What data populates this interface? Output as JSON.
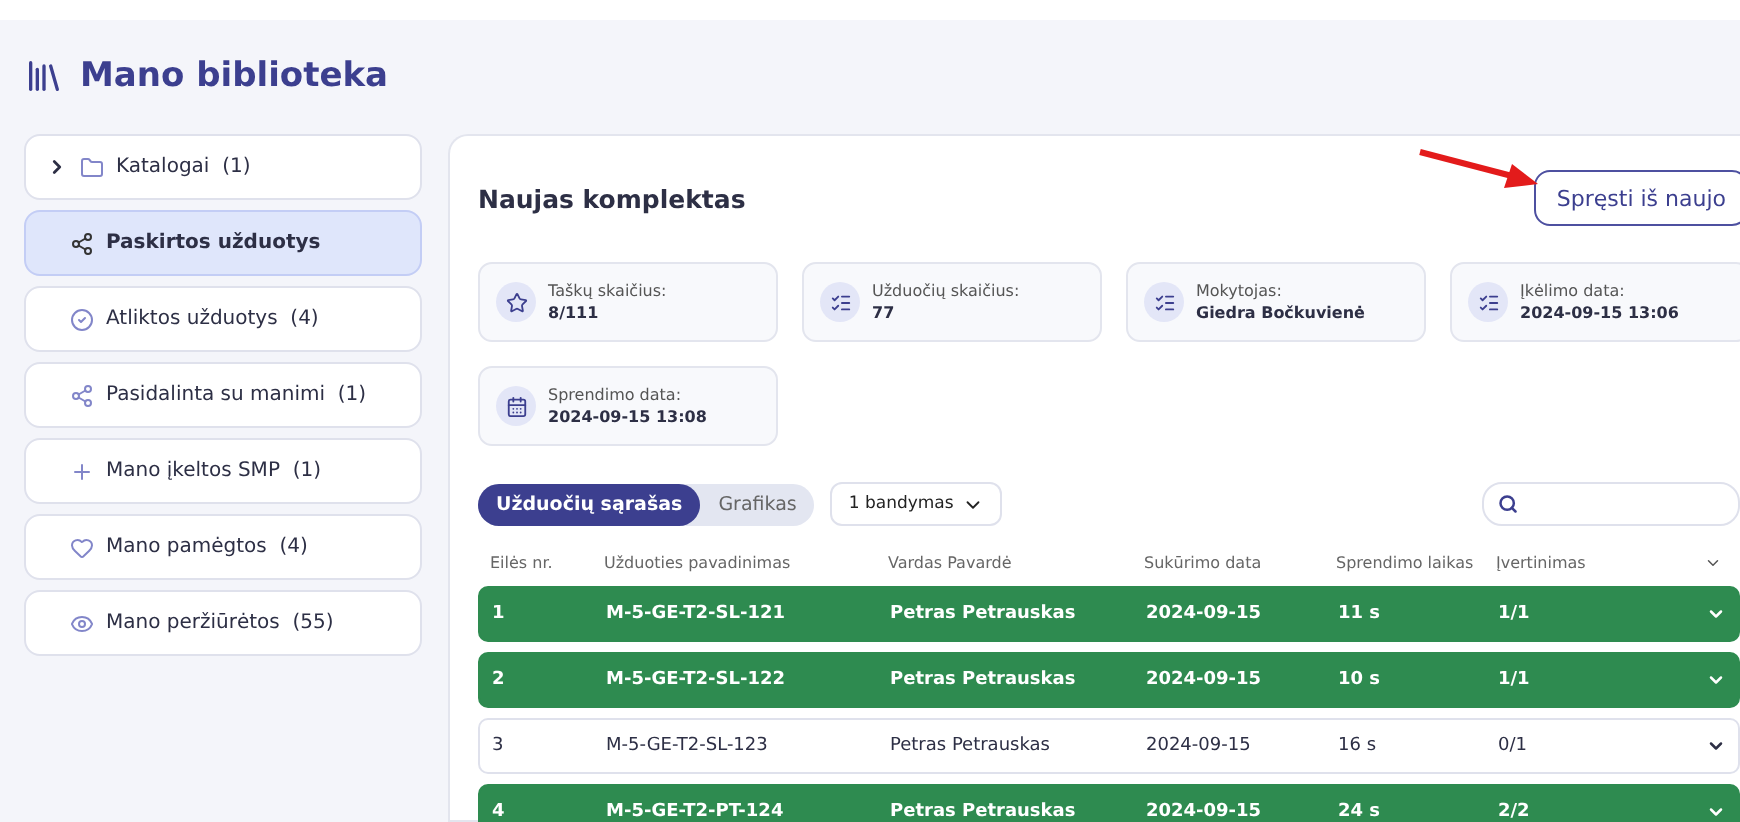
{
  "header": {
    "title": "Mano biblioteka"
  },
  "sidebar": {
    "items": [
      {
        "kind": "folder",
        "label": "Katalogai",
        "count": "(1)",
        "selected": false
      },
      {
        "kind": "share",
        "label": "Paskirtos užduotys",
        "selected": true
      },
      {
        "kind": "check",
        "label": "Atliktos užduotys",
        "count": "(4)",
        "selected": false
      },
      {
        "kind": "shared",
        "label": "Pasidalinta su manimi",
        "count": "(1)",
        "selected": false
      },
      {
        "kind": "plus",
        "label": "Mano įkeltos SMP",
        "count": "(1)",
        "selected": false
      },
      {
        "kind": "heart",
        "label": "Mano pamėgtos",
        "count": "(4)",
        "selected": false
      },
      {
        "kind": "eye",
        "label": "Mano peržiūrėtos",
        "count": "(55)",
        "selected": false
      }
    ]
  },
  "panel": {
    "title": "Naujas komplektas",
    "action": "Spręsti iš naujo",
    "info": [
      {
        "kind": "star",
        "label": "Taškų skaičius:",
        "value": "8/111"
      },
      {
        "kind": "list",
        "label": "Užduočių skaičius:",
        "value": "77"
      },
      {
        "kind": "list",
        "label": "Mokytojas:",
        "value": "Giedra Bočkuvienė"
      },
      {
        "kind": "list",
        "label": "Įkėlimo data:",
        "value": "2024-09-15 13:06"
      },
      {
        "kind": "calendar",
        "label": "Sprendimo data:",
        "value": "2024-09-15 13:08"
      }
    ],
    "tabs": [
      {
        "label": "Užduočių sąrašas",
        "selected": true
      },
      {
        "label": "Grafikas",
        "selected": false
      }
    ],
    "attempt": "1 bandymas",
    "table": {
      "columns": [
        "Eilės nr.",
        "Užduoties pavadinimas",
        "Vardas Pavardė",
        "Sukūrimo data",
        "Sprendimo laikas",
        "Įvertinimas"
      ],
      "rows": [
        {
          "cells": [
            "1",
            "M-5-GE-T2-SL-121",
            "Petras Petrauskas",
            "2024-09-15",
            "11 s",
            "1/1"
          ],
          "correct": true
        },
        {
          "cells": [
            "2",
            "M-5-GE-T2-SL-122",
            "Petras Petrauskas",
            "2024-09-15",
            "10 s",
            "1/1"
          ],
          "correct": true
        },
        {
          "cells": [
            "3",
            "M-5-GE-T2-SL-123",
            "Petras Petrauskas",
            "2024-09-15",
            "16 s",
            "0/1"
          ],
          "correct": false
        },
        {
          "cells": [
            "4",
            "M-5-GE-T2-PT-124",
            "Petras Petrauskas",
            "2024-09-15",
            "24 s",
            "2/2"
          ],
          "correct": true
        }
      ]
    }
  }
}
